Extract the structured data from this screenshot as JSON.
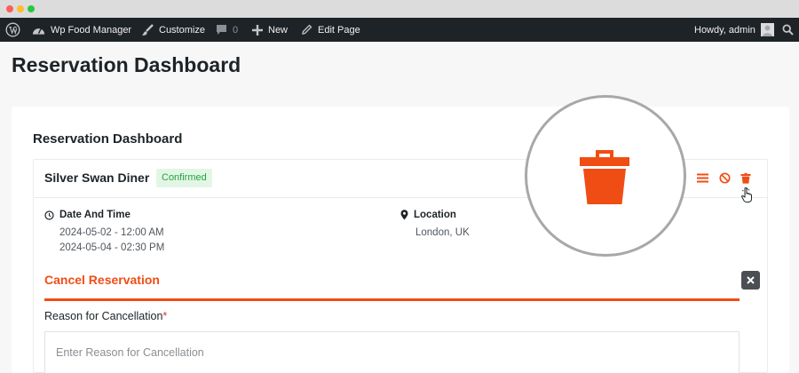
{
  "window": {
    "dots": [
      "#fe5f57",
      "#febc2e",
      "#28c840"
    ]
  },
  "admin_bar": {
    "site_name": "Wp Food Manager",
    "customize": "Customize",
    "comments_count": "0",
    "new": "New",
    "edit_page": "Edit Page",
    "howdy": "Howdy, admin"
  },
  "page": {
    "title": "Reservation Dashboard"
  },
  "dashboard": {
    "title": "Reservation Dashboard"
  },
  "reservation": {
    "name": "Silver Swan Diner",
    "status": "Confirmed",
    "date_label": "Date And Time",
    "date_start": "2024-05-02 - 12:00 AM",
    "date_end": "2024-05-04 - 02:30 PM",
    "location_label": "Location",
    "location": "London, UK"
  },
  "actions": [
    "list-icon",
    "ban-icon",
    "trash-icon"
  ],
  "cancel_form": {
    "title": "Cancel Reservation",
    "reason_label": "Reason for Cancellation",
    "required_mark": "*",
    "reason_placeholder": "Enter Reason for Cancellation",
    "reason_value": ""
  },
  "colors": {
    "accent": "#f04d14",
    "admin_bar": "#1d2327",
    "badge_bg": "#e3f6e6",
    "badge_text": "#23a43b"
  }
}
